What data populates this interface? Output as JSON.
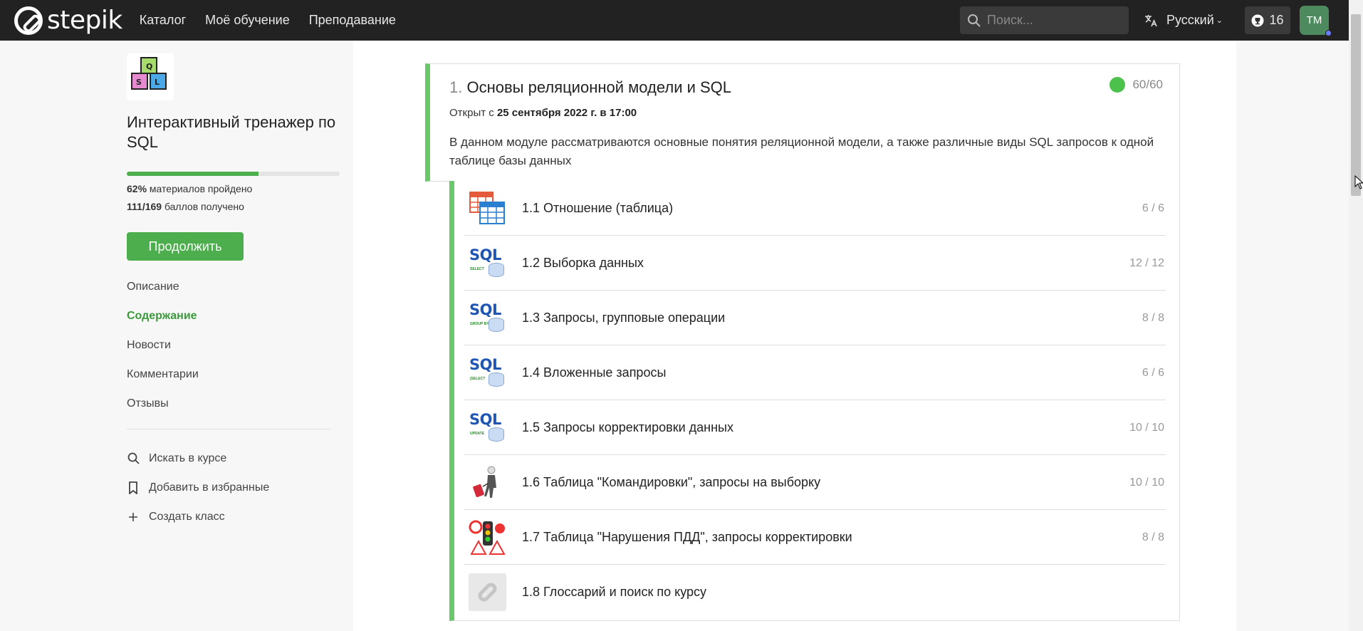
{
  "header": {
    "logo_text": "stepik",
    "nav": [
      "Каталог",
      "Моё обучение",
      "Преподавание"
    ],
    "search_placeholder": "Поиск...",
    "language": "Русский",
    "streak_count": "16",
    "avatar_initials": "ТМ"
  },
  "sidebar": {
    "course_title": "Интерактивный тренажер по SQL",
    "progress_percent": 62,
    "stat_percent": "62%",
    "stat_percent_text": "материалов пройдено",
    "stat_points": "111/169",
    "stat_points_text": "баллов получено",
    "continue_label": "Продолжить",
    "menu": [
      "Описание",
      "Содержание",
      "Новости",
      "Комментарии",
      "Отзывы"
    ],
    "active_menu": "Содержание",
    "actions": [
      "Искать в курсе",
      "Добавить в избранные",
      "Создать класс"
    ]
  },
  "module": {
    "number": "1.",
    "title": "Основы реляционной модели и SQL",
    "score": "60/60",
    "open_prefix": "Открыт с",
    "open_date": "25 сентября 2022 г. в 17:00",
    "description": "В данном модуле рассматриваются основные понятия реляционной модели, а также различные виды SQL запросов к одной таблице базы данных"
  },
  "lessons": [
    {
      "name": "1.1 Отношение (таблица)",
      "score": "6 / 6",
      "thumb": "table-icon"
    },
    {
      "name": "1.2 Выборка данных",
      "score": "12 / 12",
      "thumb": "sql-select-icon",
      "sub": "SELECT"
    },
    {
      "name": "1.3 Запросы, групповые операции",
      "score": "8 / 8",
      "thumb": "sql-groupby-icon",
      "sub": "GROUP BY"
    },
    {
      "name": "1.4 Вложенные запросы",
      "score": "6 / 6",
      "thumb": "sql-nested-icon",
      "sub": "(SELECT"
    },
    {
      "name": "1.5 Запросы корректировки данных",
      "score": "10 / 10",
      "thumb": "sql-update-icon",
      "sub": "UPDATE"
    },
    {
      "name": "1.6 Таблица \"Командировки\", запросы на выборку",
      "score": "10 / 10",
      "thumb": "traveler-icon"
    },
    {
      "name": "1.7 Таблица \"Нарушения ПДД\", запросы корректировки",
      "score": "8 / 8",
      "thumb": "traffic-light-icon"
    },
    {
      "name": "1.8 Глоссарий и поиск по курсу",
      "score": "",
      "thumb": "stepik-logo-icon"
    }
  ],
  "colors": {
    "brand_green": "#4cae4c",
    "module_accent": "#6ac76a",
    "topbar": "#222222"
  }
}
